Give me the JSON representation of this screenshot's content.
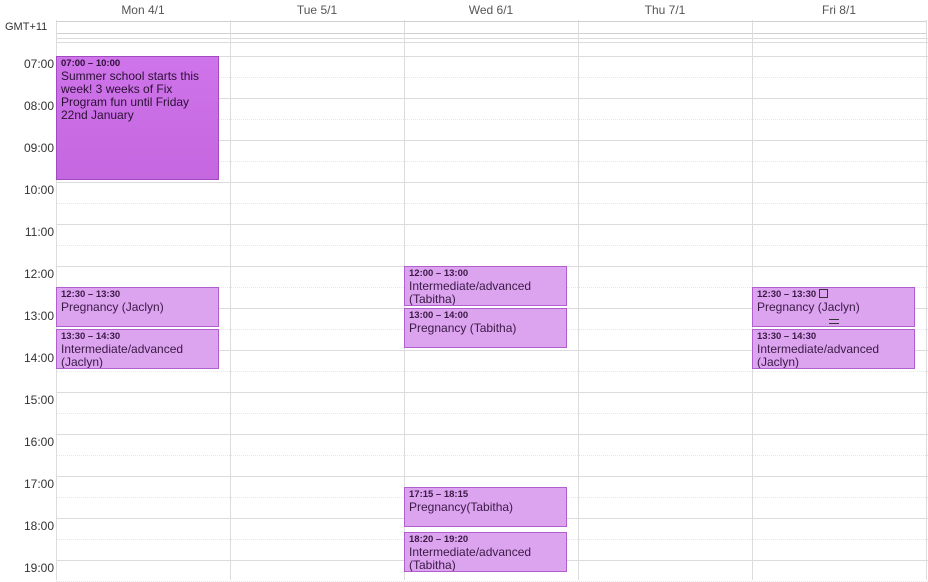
{
  "timezone_label": "GMT+11",
  "days": [
    {
      "label": "Mon 4/1"
    },
    {
      "label": "Tue 5/1"
    },
    {
      "label": "Wed 6/1"
    },
    {
      "label": "Thu 7/1"
    },
    {
      "label": "Fri 8/1"
    }
  ],
  "hours": [
    "07:00",
    "08:00",
    "09:00",
    "10:00",
    "11:00",
    "12:00",
    "13:00",
    "14:00",
    "15:00",
    "16:00",
    "17:00",
    "18:00",
    "19:00"
  ],
  "events": [
    {
      "time": "07:00 – 10:00",
      "title": "Summer school starts this week! 3 weeks of Fix Program fun until Friday 22nd January"
    },
    {
      "time": "12:30 – 13:30",
      "title": "Pregnancy (Jaclyn)"
    },
    {
      "time": "13:30 – 14:30",
      "title": "Intermediate/advanced (Jaclyn)"
    },
    {
      "time": "12:00 – 13:00",
      "title": "Intermediate/advanced (Tabitha)"
    },
    {
      "time": "13:00 – 14:00",
      "title": "Pregnancy (Tabitha)"
    },
    {
      "time": "17:15 – 18:15",
      "title": "Pregnancy(Tabitha)"
    },
    {
      "time": "18:20 – 19:20",
      "title": "Intermediate/advanced (Tabitha)"
    },
    {
      "time": "12:30 – 13:30",
      "title": "Pregnancy (Jaclyn)"
    },
    {
      "time": "13:30 – 14:30",
      "title": "Intermediate/advanced (Jaclyn)"
    }
  ]
}
